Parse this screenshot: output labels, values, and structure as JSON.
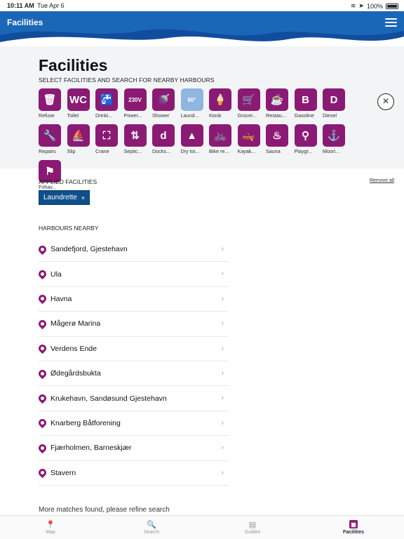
{
  "status": {
    "time": "10:11 AM",
    "date": "Tue Apr 6",
    "battery": "100%"
  },
  "header": {
    "title": "Facilities"
  },
  "facilities_panel": {
    "title": "Facilities",
    "subtitle": "SELECT FACILITIES AND SEARCH FOR NEARBY HARBOURS",
    "items": [
      {
        "label": "Refuse",
        "glyph": "🗑",
        "icon": "refuse-icon",
        "selected": false
      },
      {
        "label": "Toilet",
        "glyph": "WC",
        "icon": "toilet-icon",
        "selected": false
      },
      {
        "label": "Drinki...",
        "glyph": "🚰",
        "icon": "drinking-water-icon",
        "selected": false
      },
      {
        "label": "Power...",
        "glyph": "230V",
        "icon": "power-icon",
        "selected": false
      },
      {
        "label": "Shower",
        "glyph": "🚿",
        "icon": "shower-icon",
        "selected": false
      },
      {
        "label": "Laund...",
        "glyph": "60°",
        "icon": "laundrette-icon",
        "selected": true
      },
      {
        "label": "Kiosk",
        "glyph": "🍦",
        "icon": "kiosk-icon",
        "selected": false
      },
      {
        "label": "Grocer...",
        "glyph": "🛒",
        "icon": "grocery-icon",
        "selected": false
      },
      {
        "label": "Restau...",
        "glyph": "☕",
        "icon": "restaurant-icon",
        "selected": false
      },
      {
        "label": "Gasoline",
        "glyph": "B",
        "icon": "gasoline-icon",
        "selected": false
      },
      {
        "label": "Diesel",
        "glyph": "D",
        "icon": "diesel-icon",
        "selected": false
      },
      {
        "label": "Repairs",
        "glyph": "🔧",
        "icon": "repairs-icon",
        "selected": false
      },
      {
        "label": "Slip",
        "glyph": "⛵",
        "icon": "slip-icon",
        "selected": false
      },
      {
        "label": "Crane",
        "glyph": "⛶",
        "icon": "crane-icon",
        "selected": false
      },
      {
        "label": "Septic...",
        "glyph": "⇅",
        "icon": "septic-icon",
        "selected": false
      },
      {
        "label": "Docks...",
        "glyph": "d",
        "icon": "docks-icon",
        "selected": false
      },
      {
        "label": "Dry toi...",
        "glyph": "▲",
        "icon": "dry-toilet-icon",
        "selected": false
      },
      {
        "label": "Bike re...",
        "glyph": "🚲",
        "icon": "bike-rental-icon",
        "selected": false
      },
      {
        "label": "Kayak...",
        "glyph": "🛶",
        "icon": "kayak-icon",
        "selected": false
      },
      {
        "label": "Sauna",
        "glyph": "♨",
        "icon": "sauna-icon",
        "selected": false
      },
      {
        "label": "Playgr...",
        "glyph": "⚲",
        "icon": "playground-icon",
        "selected": false
      },
      {
        "label": "Moori...",
        "glyph": "⚓",
        "icon": "mooring-icon",
        "selected": false
      },
      {
        "label": "Frihav...",
        "glyph": "⚑",
        "icon": "free-harbour-icon",
        "selected": false
      }
    ]
  },
  "applied": {
    "label": "APPLIED FACILITIES",
    "remove_all": "Remove all",
    "chips": [
      {
        "label": "Laundrette",
        "remove": "×"
      }
    ]
  },
  "harbours": {
    "label": "HARBOURS NEARBY",
    "items": [
      "Sandefjord, Gjestehavn",
      "Ula",
      "Havna",
      "Mågerø Marina",
      "Verdens Ende",
      "Ødegårdsbukta",
      "Krukehavn, Sandøsund Gjestehavn",
      "Knarberg Båtforening",
      "Fjærholmen, Barneskjær",
      "Stavern"
    ],
    "more": "More matches found, please refine search"
  },
  "tabs": [
    {
      "label": "Map",
      "icon": "map-pin-icon",
      "glyph": "📍",
      "active": false
    },
    {
      "label": "Search",
      "icon": "search-icon",
      "glyph": "🔍",
      "active": false
    },
    {
      "label": "Guides",
      "icon": "guides-icon",
      "glyph": "▤",
      "active": false
    },
    {
      "label": "Facilities",
      "icon": "facilities-icon",
      "glyph": "▣",
      "active": true
    }
  ],
  "colors": {
    "brand": "#8b1a74",
    "header_blue": "#1a67b8",
    "chip_blue": "#0e4f8c",
    "selected_tile": "#8fb6de"
  }
}
